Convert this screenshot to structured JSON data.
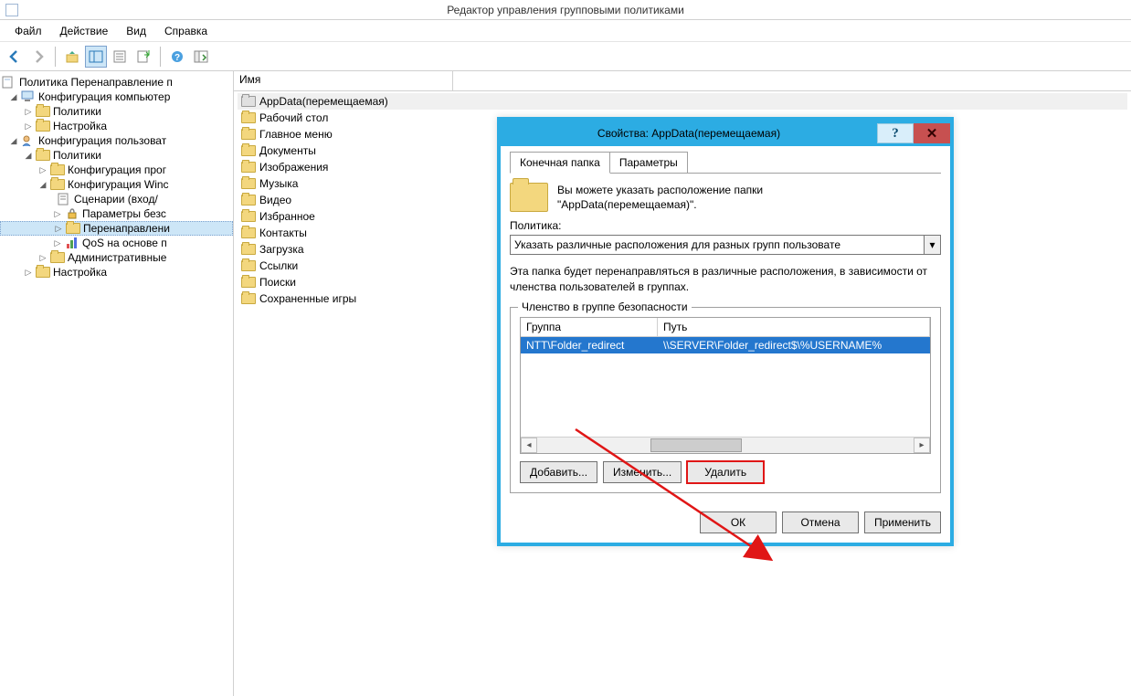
{
  "window": {
    "title": "Редактор управления групповыми политиками"
  },
  "menu": {
    "file": "Файл",
    "action": "Действие",
    "view": "Вид",
    "help": "Справка"
  },
  "tree": {
    "root": "Политика Перенаправление п",
    "computer_config": "Конфигурация компьютер",
    "policies": "Политики",
    "settings": "Настройка",
    "user_config": "Конфигурация пользоват",
    "soft_config": "Конфигурация прог",
    "win_config": "Конфигурация Winc",
    "scripts": "Сценарии (вход/",
    "security": "Параметры безс",
    "redirection": "Перенаправлени",
    "qos": "QoS на основе п",
    "admin": "Административные"
  },
  "list": {
    "header_name": "Имя",
    "items": [
      "AppData(перемещаемая)",
      "Рабочий стол",
      "Главное меню",
      "Документы",
      "Изображения",
      "Музыка",
      "Видео",
      "Избранное",
      "Контакты",
      "Загрузка",
      "Ссылки",
      "Поиски",
      "Сохраненные игры"
    ]
  },
  "dialog": {
    "title": "Свойства: AppData(перемещаемая)",
    "tab_target": "Конечная папка",
    "tab_params": "Параметры",
    "info1": "Вы можете указать расположение папки",
    "info2": "\"AppData(перемещаемая)\".",
    "policy_label": "Политика:",
    "policy_value": "Указать различные расположения для разных групп пользовате",
    "desc": "Эта папка будет перенаправляться в различные расположения, в зависимости от членства пользователей в группах.",
    "groupbox_legend": "Членство в группе безопасности",
    "col_group": "Группа",
    "col_path": "Путь",
    "row_group": "NTT\\Folder_redirect",
    "row_path": "\\\\SERVER\\Folder_redirect$\\%USERNAME%",
    "btn_add": "Добавить...",
    "btn_edit": "Изменить...",
    "btn_delete": "Удалить",
    "btn_ok": "ОК",
    "btn_cancel": "Отмена",
    "btn_apply": "Применить"
  }
}
